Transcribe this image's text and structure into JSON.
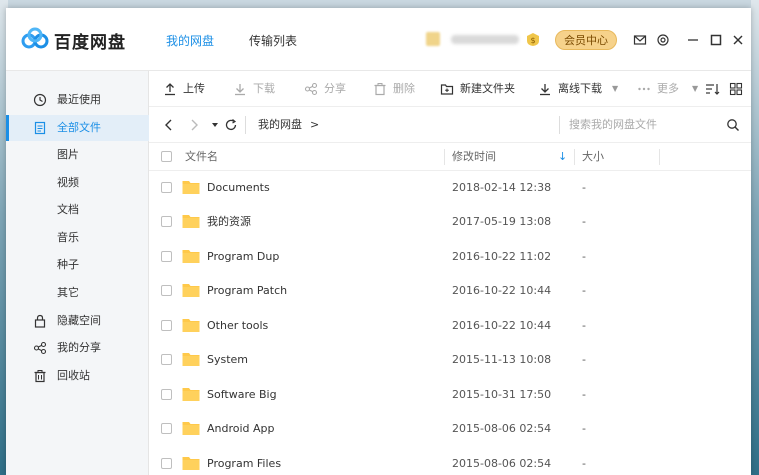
{
  "app": {
    "brand": "百度网盘"
  },
  "header": {
    "tabs": [
      {
        "label": "我的网盘",
        "active": true
      },
      {
        "label": "传输列表",
        "active": false
      }
    ],
    "member_button": "会员中心",
    "accent_color": "#1b8fe6",
    "icons": [
      "mail-icon",
      "settings-icon",
      "minimize-icon",
      "maximize-icon",
      "close-icon"
    ]
  },
  "sidebar": {
    "items": [
      {
        "label": "最近使用",
        "icon": "clock-icon"
      },
      {
        "label": "全部文件",
        "icon": "document-icon",
        "active": true
      },
      {
        "label": "图片",
        "sub": true
      },
      {
        "label": "视频",
        "sub": true
      },
      {
        "label": "文档",
        "sub": true
      },
      {
        "label": "音乐",
        "sub": true
      },
      {
        "label": "种子",
        "sub": true
      },
      {
        "label": "其它",
        "sub": true
      },
      {
        "label": "隐藏空间",
        "icon": "lock-icon"
      },
      {
        "label": "我的分享",
        "icon": "share-icon"
      },
      {
        "label": "回收站",
        "icon": "trash-icon"
      }
    ]
  },
  "toolbar": {
    "upload": "上传",
    "download": "下载",
    "share": "分享",
    "delete": "删除",
    "new_folder": "新建文件夹",
    "offline_download": "离线下载",
    "more": "更多"
  },
  "pathbar": {
    "root": "我的网盘",
    "arrow": ">",
    "search_placeholder": "搜索我的网盘文件"
  },
  "table": {
    "columns": {
      "name": "文件名",
      "modified": "修改时间",
      "size": "大小"
    },
    "rows": [
      {
        "name": "Documents",
        "modified": "2018-02-14 12:38",
        "size": "-"
      },
      {
        "name": "我的资源",
        "modified": "2017-05-19 13:08",
        "size": "-"
      },
      {
        "name": "Program Dup",
        "modified": "2016-10-22 11:02",
        "size": "-"
      },
      {
        "name": "Program Patch",
        "modified": "2016-10-22 10:44",
        "size": "-"
      },
      {
        "name": "Other tools",
        "modified": "2016-10-22 10:44",
        "size": "-"
      },
      {
        "name": "System",
        "modified": "2015-11-13 10:08",
        "size": "-"
      },
      {
        "name": "Software Big",
        "modified": "2015-10-31 17:50",
        "size": "-"
      },
      {
        "name": "Android App",
        "modified": "2015-08-06 02:54",
        "size": "-"
      },
      {
        "name": "Program Files",
        "modified": "2015-08-06 02:54",
        "size": "-"
      }
    ]
  }
}
